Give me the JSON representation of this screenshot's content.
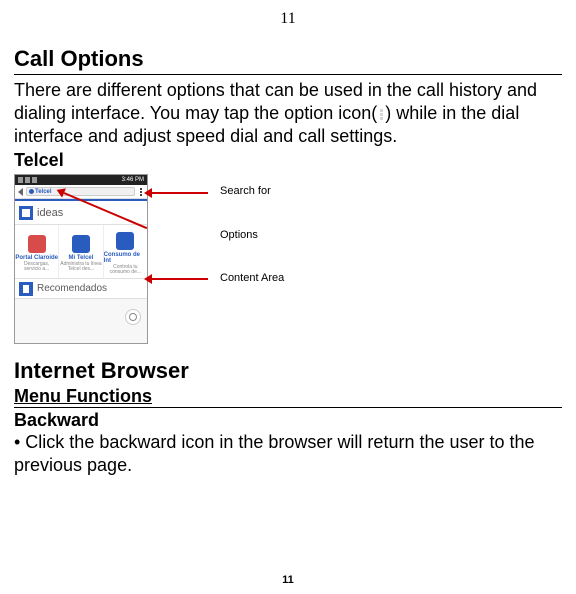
{
  "page_number_top": "11",
  "page_number_bottom": "11",
  "call_options": {
    "heading": "Call Options",
    "description": "There are different options that can be used in the call history and dialing interface. You may tap the option icon( ) while in the dial interface and adjust speed dial and call settings."
  },
  "telcel": {
    "heading": "Telcel",
    "statusbar_time": "3:46 PM",
    "url_brand": "Telcel",
    "ideas_label": "ideas",
    "tiles": [
      {
        "label": "Portal Claroide",
        "sub": "Descargas, servicio a..."
      },
      {
        "label": "Mi Telcel",
        "sub": "Administra tu línea Telcel des..."
      },
      {
        "label": "Consumo de Int",
        "sub": "Controla tu consumo de..."
      }
    ],
    "recomendados": "Recomendados",
    "annotations": {
      "search_for": "Search for",
      "options": "Options",
      "content_area": "Content Area"
    }
  },
  "internet_browser": {
    "heading": "Internet Browser",
    "menu_functions": "Menu Functions",
    "backward_heading": "Backward",
    "backward_text": "• Click the backward icon in the browser will return the user to the previous page."
  }
}
